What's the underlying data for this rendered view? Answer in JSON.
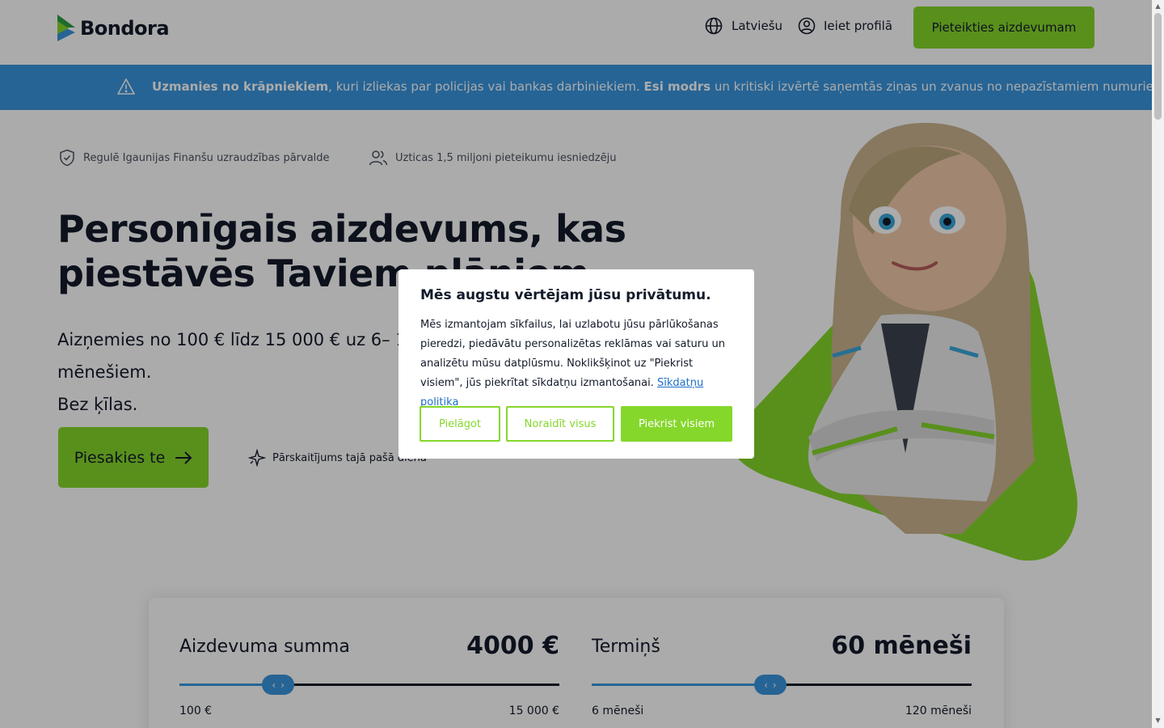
{
  "header": {
    "brand": "Bondora",
    "language": "Latviešu",
    "login": "Ieiet profilā",
    "apply_button": "Pieteikties aizdevumam"
  },
  "banner": {
    "bold1": "Uzmanies no krāpniekiem",
    "text1": ", kuri izliekas par policijas vai bankas darbiniekiem. ",
    "bold2": "Esi modrs",
    "text2": " un kritiski izvērtē saņemtās ziņas un zvanus no nepazīstamiem numuriem."
  },
  "hero": {
    "trust_regulated": "Regulē Igaunijas Finanšu uzraudzības pārvalde",
    "trust_users": "Uzticas 1,5 miljoni pieteikumu iesniedzēju",
    "title": "Personīgais aizdevums, kas piestāvēs Taviem plāniem",
    "subtitle_line1": "Aizņemies no 100 € līdz 15 000 € uz 6– 120 mēnešiem.",
    "subtitle_line2": "Bez ķīlas.",
    "cta": "Piesakies te",
    "same_day": "Pārskaitījums tajā pašā dienā"
  },
  "calculator": {
    "amount": {
      "label": "Aizdevuma summa",
      "value": "4000 €",
      "min": "100 €",
      "max": "15 000 €",
      "fraction": 0.26
    },
    "term": {
      "label": "Termiņš",
      "value": "60 mēneši",
      "min": "6 mēneši",
      "max": "120 mēneši",
      "fraction": 0.47
    }
  },
  "cookie_modal": {
    "title": "Mēs augstu vērtējam jūsu privātumu.",
    "body": "Mēs izmantojam sīkfailus, lai uzlabotu jūsu pārlūkošanas pieredzi, piedāvātu personalizētas reklāmas vai saturu un analizētu mūsu datplūsmu. Noklikšķinot uz \"Piekrist visiem\", jūs piekrītat sīkdatņu izmantošanai. ",
    "policy_link": "Sīkdatņu politika",
    "customize": "Pielāgot",
    "reject_all": "Noraidīt visus",
    "accept_all": "Piekrist visiem"
  },
  "colors": {
    "brand_green": "#85d72b",
    "banner_blue": "#3a95de",
    "text_dark": "#121a2a"
  },
  "icons": [
    "bondora-logo-icon",
    "globe-icon",
    "user-circle-icon",
    "warning-icon",
    "shield-check-icon",
    "users-icon",
    "arrow-right-icon",
    "sparkle-icon",
    "chevron-left-icon",
    "chevron-right-icon"
  ]
}
